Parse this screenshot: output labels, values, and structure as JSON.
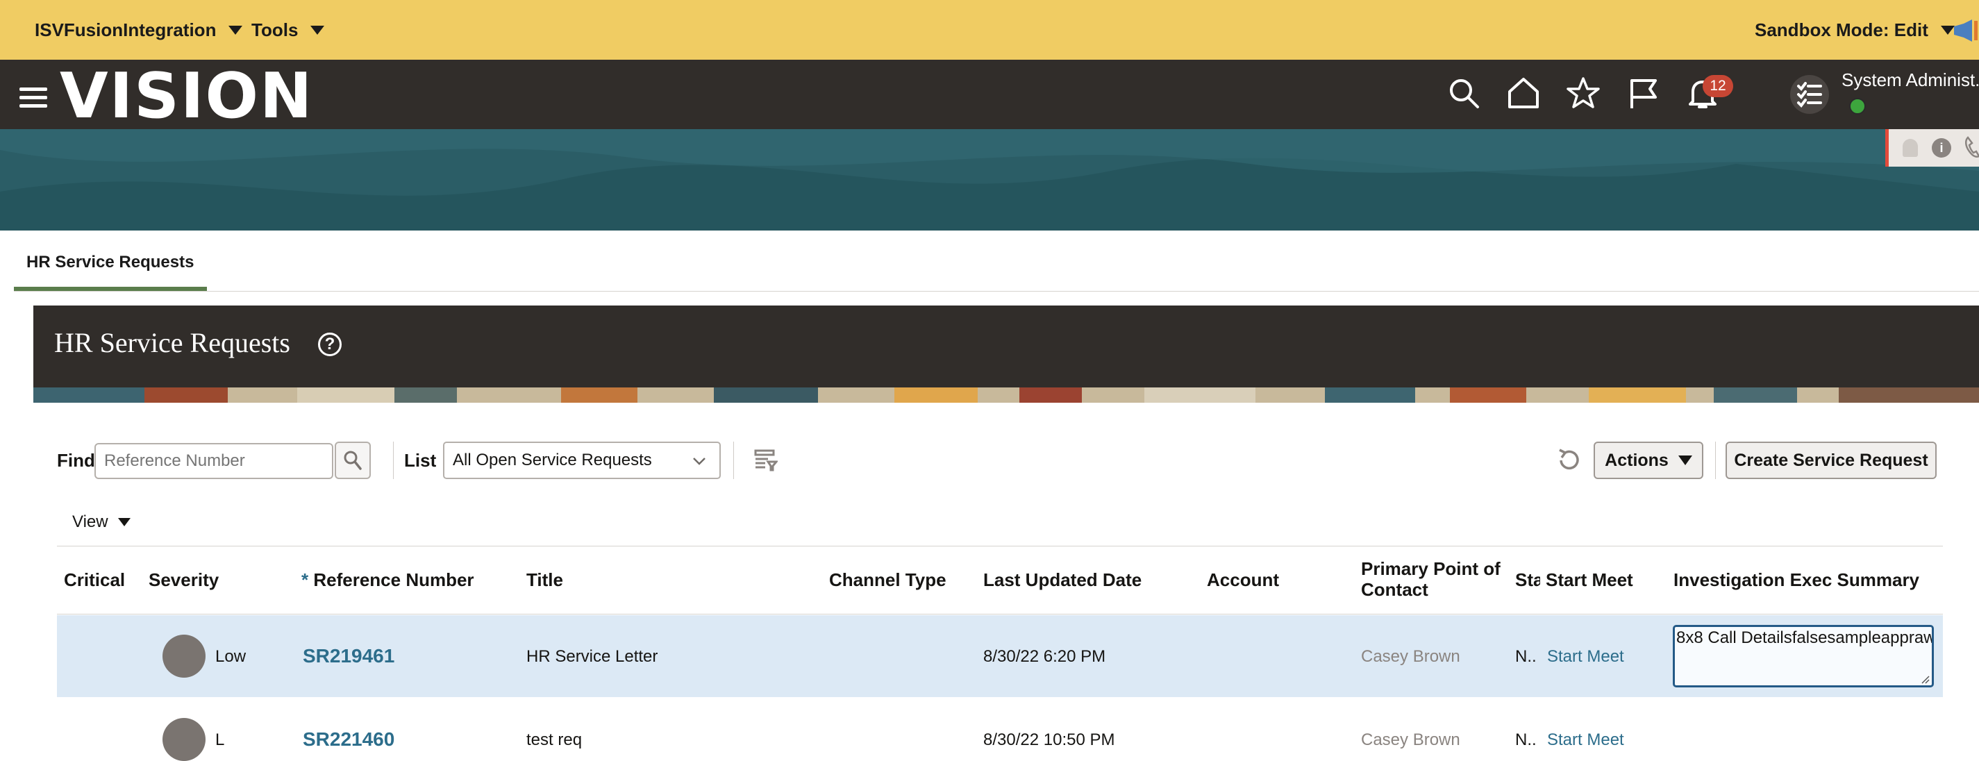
{
  "topbar": {
    "app_menu": "ISVFusionIntegration",
    "tools_menu": "Tools",
    "sandbox": "Sandbox Mode: Edit"
  },
  "brand": {
    "logo": "VISION",
    "notifications_count": "12",
    "user_name": "System Administ..."
  },
  "page_tab": "HR Service Requests",
  "header": {
    "title": "HR Service Requests",
    "help_symbol": "?"
  },
  "toolbar": {
    "find_label": "Find",
    "find_placeholder": "Reference Number",
    "list_label": "List",
    "list_value": "All Open Service Requests",
    "view_label": "View",
    "actions_label": "Actions",
    "create_label": "Create Service Request"
  },
  "table": {
    "headers": {
      "critical": "Critical",
      "severity": "Severity",
      "ref_asterisk": "*",
      "reference": "Reference Number",
      "title": "Title",
      "channel": "Channel Type",
      "updated": "Last Updated Date",
      "account": "Account",
      "contact_1": "Primary Point of",
      "contact_2": "Contact",
      "status": "Sta",
      "start_meet": "Start Meet",
      "summary": "Investigation Exec Summary"
    },
    "rows": [
      {
        "severity": "Low",
        "reference": "SR219461",
        "title": "HR Service Letter",
        "updated": "8/30/22 6:20 PM",
        "contact": "Casey Brown",
        "status": "N..",
        "start_meet": "Start Meet",
        "summary": "8x8 Call Detailsfalsesampleappraw"
      },
      {
        "severity": "L",
        "reference": "SR221460",
        "title": "test req",
        "updated": "8/30/22 10:50 PM",
        "contact": "Casey Brown",
        "status": "N..",
        "start_meet": "Start Meet"
      }
    ]
  },
  "colors": {
    "topbar": "#f0cc63",
    "brandbar": "#312d2a",
    "banner": "#2b5d66",
    "selected_row": "#dce9f5",
    "link": "#2c6d8b",
    "badge": "#c74634"
  }
}
